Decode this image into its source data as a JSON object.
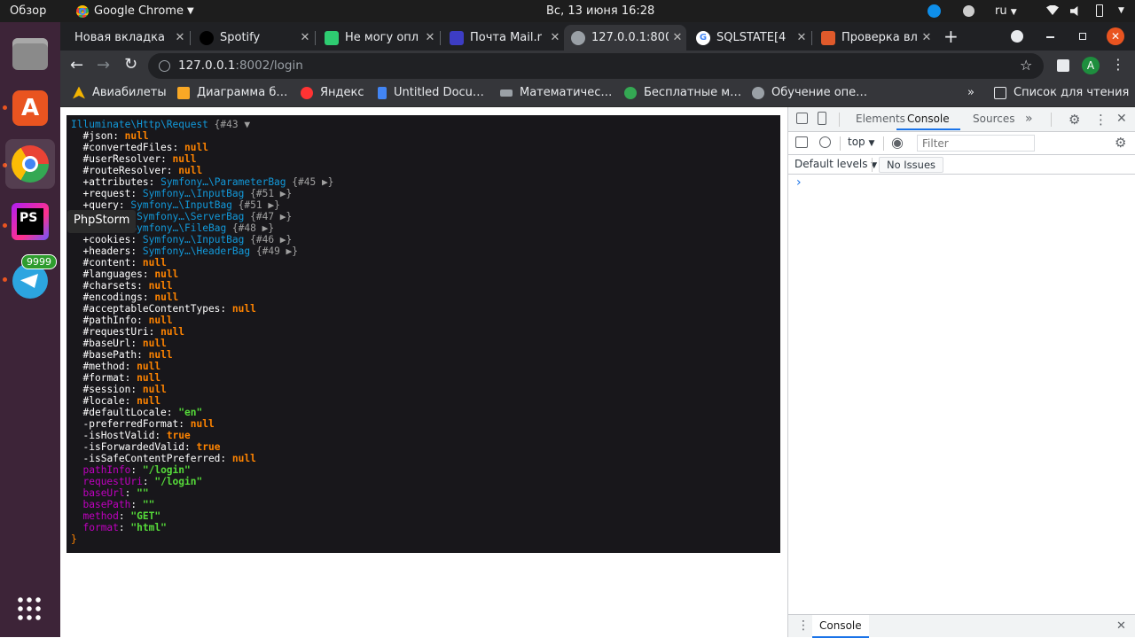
{
  "topbar": {
    "activities": "Обзор",
    "app_menu": "Google Chrome",
    "app_menu_arrow": "▼",
    "clock": "Вс, 13 июня  16:28",
    "lang": "ru",
    "lang_arrow": "▼"
  },
  "dock": {
    "badge": "9999",
    "tooltip": "PhpStorm"
  },
  "tabs": [
    {
      "title": "Новая вкладка",
      "color": "#202124"
    },
    {
      "title": "Spotify",
      "color": "#1db954"
    },
    {
      "title": "Не могу опл",
      "color": "#2ecc71"
    },
    {
      "title": "Почта Mail.r",
      "color": "#3d3dc4"
    },
    {
      "title": "127.0.0.1:800",
      "color": "#5f6368"
    },
    {
      "title": "SQLSTATE[4",
      "color": "#4285f4"
    },
    {
      "title": "Проверка вл",
      "color": "#e05a2b"
    }
  ],
  "tab_close": "✕",
  "new_tab": "+",
  "address": {
    "host": "127.0.0.1",
    "path": ":8002/login"
  },
  "profile_letter": "A",
  "bookmarks": [
    {
      "label": "Авиабилеты",
      "color": "#f4b400"
    },
    {
      "label": "Диаграмма б…",
      "color": "#f9a825"
    },
    {
      "label": "Яндекс",
      "color": "#ff3333"
    },
    {
      "label": "Untitled Docu…",
      "color": "#4285f4"
    },
    {
      "label": "Математичес…",
      "color": "#9aa0a6"
    },
    {
      "label": "Бесплатные м…",
      "color": "#34a853"
    },
    {
      "label": "Обучение опе…",
      "color": "#9aa0a6"
    }
  ],
  "bookmarks_more": "»",
  "reading_list": "Список для чтения",
  "dump": {
    "head_class": "Illuminate\\Http\\Request",
    "head_ref": "{#43",
    "head_toggle": "▼",
    "lines": [
      {
        "pre": "#",
        "key": "json",
        "kind": "n",
        "val": "null"
      },
      {
        "pre": "#",
        "key": "convertedFiles",
        "kind": "n",
        "val": "null"
      },
      {
        "pre": "#",
        "key": "userResolver",
        "kind": "n",
        "val": "null"
      },
      {
        "pre": "#",
        "key": "routeResolver",
        "kind": "n",
        "val": "null"
      },
      {
        "pre": "+",
        "key": "attributes",
        "kind": "c",
        "val": "Symfony…\\ParameterBag",
        "ref": "{#45 ▶}"
      },
      {
        "pre": "+",
        "key": "request",
        "kind": "c",
        "val": "Symfony…\\InputBag",
        "ref": "{#51 ▶}"
      },
      {
        "pre": "+",
        "key": "query",
        "kind": "c",
        "val": "Symfony…\\InputBag",
        "ref": "{#51 ▶}"
      },
      {
        "pre": "+",
        "key": "server",
        "kind": "c",
        "val": "Symfony…\\ServerBag",
        "ref": "{#47 ▶}"
      },
      {
        "pre": "+",
        "key": "files",
        "kind": "c",
        "val": "Symfony…\\FileBag",
        "ref": "{#48 ▶}"
      },
      {
        "pre": "+",
        "key": "cookies",
        "kind": "c",
        "val": "Symfony…\\InputBag",
        "ref": "{#46 ▶}"
      },
      {
        "pre": "+",
        "key": "headers",
        "kind": "c",
        "val": "Symfony…\\HeaderBag",
        "ref": "{#49 ▶}"
      },
      {
        "pre": "#",
        "key": "content",
        "kind": "n",
        "val": "null"
      },
      {
        "pre": "#",
        "key": "languages",
        "kind": "n",
        "val": "null"
      },
      {
        "pre": "#",
        "key": "charsets",
        "kind": "n",
        "val": "null"
      },
      {
        "pre": "#",
        "key": "encodings",
        "kind": "n",
        "val": "null"
      },
      {
        "pre": "#",
        "key": "acceptableContentTypes",
        "kind": "n",
        "val": "null"
      },
      {
        "pre": "#",
        "key": "pathInfo",
        "kind": "n",
        "val": "null"
      },
      {
        "pre": "#",
        "key": "requestUri",
        "kind": "n",
        "val": "null"
      },
      {
        "pre": "#",
        "key": "baseUrl",
        "kind": "n",
        "val": "null"
      },
      {
        "pre": "#",
        "key": "basePath",
        "kind": "n",
        "val": "null"
      },
      {
        "pre": "#",
        "key": "method",
        "kind": "n",
        "val": "null"
      },
      {
        "pre": "#",
        "key": "format",
        "kind": "n",
        "val": "null"
      },
      {
        "pre": "#",
        "key": "session",
        "kind": "n",
        "val": "null"
      },
      {
        "pre": "#",
        "key": "locale",
        "kind": "n",
        "val": "null"
      },
      {
        "pre": "#",
        "key": "defaultLocale",
        "kind": "s",
        "val": "\"en\""
      },
      {
        "pre": "-",
        "key": "preferredFormat",
        "kind": "n",
        "val": "null"
      },
      {
        "pre": "-",
        "key": "isHostValid",
        "kind": "n",
        "val": "true"
      },
      {
        "pre": "-",
        "key": "isForwardedValid",
        "kind": "n",
        "val": "true"
      },
      {
        "pre": "-",
        "key": "isSafeContentPreferred",
        "kind": "n",
        "val": "null"
      },
      {
        "pre": "",
        "key": "pathInfo",
        "kind": "s",
        "val": "\"/login\"",
        "virtual": true
      },
      {
        "pre": "",
        "key": "requestUri",
        "kind": "s",
        "val": "\"/login\"",
        "virtual": true
      },
      {
        "pre": "",
        "key": "baseUrl",
        "kind": "s",
        "val": "\"\"",
        "virtual": true
      },
      {
        "pre": "",
        "key": "basePath",
        "kind": "s",
        "val": "\"\"",
        "virtual": true
      },
      {
        "pre": "",
        "key": "method",
        "kind": "s",
        "val": "\"GET\"",
        "virtual": true
      },
      {
        "pre": "",
        "key": "format",
        "kind": "s",
        "val": "\"html\"",
        "virtual": true
      }
    ],
    "close": "}"
  },
  "devtools": {
    "tabs": [
      "Elements",
      "Console",
      "Sources"
    ],
    "more": "»",
    "context": "top",
    "context_arrow": "▼",
    "filter_placeholder": "Filter",
    "levels": "Default levels",
    "levels_arrow": "▼",
    "issues": "No Issues",
    "prompt": "›",
    "drawer_tab": "Console",
    "drawer_close": "✕"
  }
}
